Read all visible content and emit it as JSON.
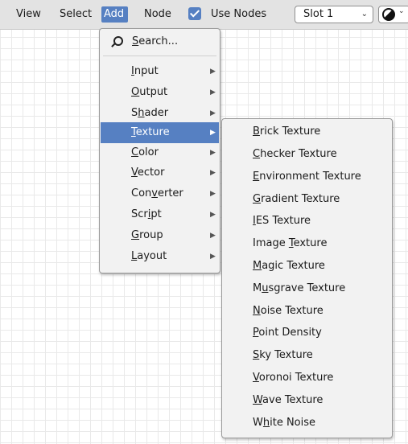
{
  "header": {
    "menus": [
      {
        "pre": "View",
        "u": "",
        "post": ""
      },
      {
        "pre": "Select",
        "u": "",
        "post": ""
      },
      {
        "pre": "Add",
        "u": "",
        "post": ""
      },
      {
        "pre": "Node",
        "u": "",
        "post": ""
      }
    ],
    "use_nodes_label": "Use Nodes",
    "use_nodes_checked": true,
    "slot_value": "Slot 1",
    "accent_color": "#5680c2"
  },
  "add_menu": {
    "search": {
      "pre": "",
      "u": "S",
      "post": "earch..."
    },
    "items": [
      {
        "pre": "",
        "u": "I",
        "post": "nput"
      },
      {
        "pre": "",
        "u": "O",
        "post": "utput"
      },
      {
        "pre": "S",
        "u": "h",
        "post": "ader"
      },
      {
        "pre": "",
        "u": "T",
        "post": "exture"
      },
      {
        "pre": "",
        "u": "C",
        "post": "olor"
      },
      {
        "pre": "",
        "u": "V",
        "post": "ector"
      },
      {
        "pre": "Con",
        "u": "v",
        "post": "erter"
      },
      {
        "pre": "Scr",
        "u": "i",
        "post": "pt"
      },
      {
        "pre": "",
        "u": "G",
        "post": "roup"
      },
      {
        "pre": "",
        "u": "L",
        "post": "ayout"
      }
    ],
    "highlighted": "Texture",
    "submenu_arrow": "▶"
  },
  "texture_menu": {
    "items": [
      {
        "pre": "",
        "u": "B",
        "post": "rick Texture"
      },
      {
        "pre": "",
        "u": "C",
        "post": "hecker Texture"
      },
      {
        "pre": "",
        "u": "E",
        "post": "nvironment Texture"
      },
      {
        "pre": "",
        "u": "G",
        "post": "radient Texture"
      },
      {
        "pre": "",
        "u": "I",
        "post": "ES Texture"
      },
      {
        "pre": "Image ",
        "u": "T",
        "post": "exture"
      },
      {
        "pre": "",
        "u": "M",
        "post": "agic Texture"
      },
      {
        "pre": "M",
        "u": "u",
        "post": "sgrave Texture"
      },
      {
        "pre": "",
        "u": "N",
        "post": "oise Texture"
      },
      {
        "pre": "",
        "u": "P",
        "post": "oint Density"
      },
      {
        "pre": "",
        "u": "S",
        "post": "ky Texture"
      },
      {
        "pre": "",
        "u": "V",
        "post": "oronoi Texture"
      },
      {
        "pre": "",
        "u": "W",
        "post": "ave Texture"
      },
      {
        "pre": "W",
        "u": "h",
        "post": "ite Noise"
      }
    ]
  }
}
